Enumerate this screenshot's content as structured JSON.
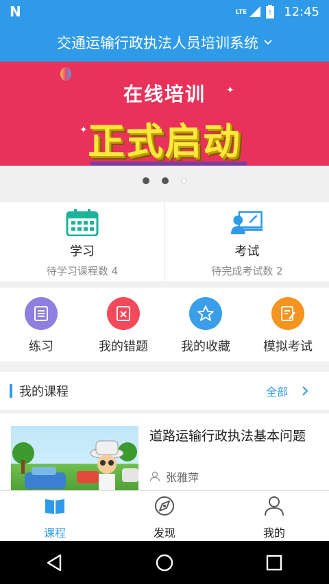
{
  "status_bar": {
    "network": "LTE",
    "time": "12:45"
  },
  "app_bar": {
    "title": "交通运输行政执法人员培训系统"
  },
  "banner": {
    "top_text": "在线培训",
    "main_text": "正式启动"
  },
  "carousel": {
    "count": 3,
    "active_index": 1
  },
  "cards": [
    {
      "title": "学习",
      "subtitle": "待学习课程数  4",
      "icon": "calendar-icon"
    },
    {
      "title": "考试",
      "subtitle": "待完成考试数  2",
      "icon": "exam-icon"
    }
  ],
  "functions": [
    {
      "label": "练习",
      "icon": "practice-icon",
      "color": "#8e7fe0"
    },
    {
      "label": "我的错题",
      "icon": "wrong-questions-icon",
      "color": "#f24a5a"
    },
    {
      "label": "我的收藏",
      "icon": "favorite-star-icon",
      "color": "#3a9ee8"
    },
    {
      "label": "模拟考试",
      "icon": "mock-exam-icon",
      "color": "#f5941e"
    }
  ],
  "courses_section": {
    "title": "我的课程",
    "all_label": "全部"
  },
  "course": {
    "title": "道路运输行政执法基本问题",
    "author": "张雅萍"
  },
  "tabs": [
    {
      "label": "课程",
      "icon": "book-icon",
      "active": true
    },
    {
      "label": "发现",
      "icon": "compass-icon",
      "active": false
    },
    {
      "label": "我的",
      "icon": "user-icon",
      "active": false
    }
  ],
  "colors": {
    "primary": "#2f9be8",
    "banner": "#e8325a"
  }
}
